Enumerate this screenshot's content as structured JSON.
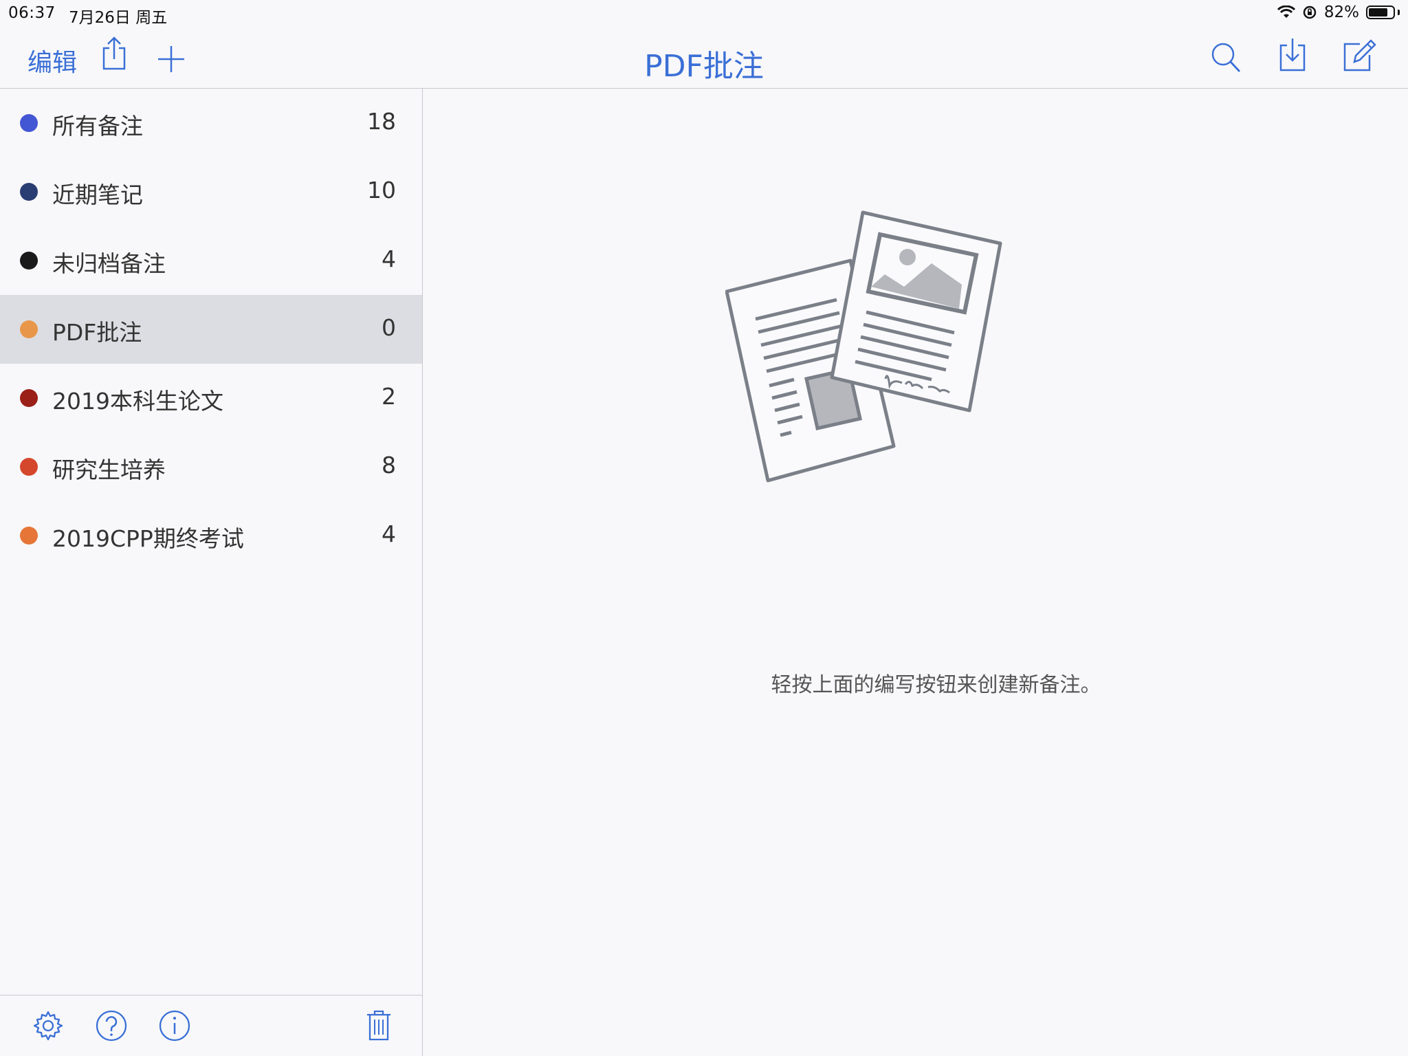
{
  "status": {
    "time": "06:37",
    "date": "7月26日 周五",
    "battery": "82%",
    "battery_level": 0.82
  },
  "nav": {
    "edit_label": "编辑",
    "title": "PDF批注"
  },
  "sidebar": {
    "items": [
      {
        "label": "所有备注",
        "count": "18",
        "color": "#4356d4"
      },
      {
        "label": "近期笔记",
        "count": "10",
        "color": "#2a3d73"
      },
      {
        "label": "未归档备注",
        "count": "4",
        "color": "#1a1a1a"
      },
      {
        "label": "PDF批注",
        "count": "0",
        "color": "#e8974a",
        "selected": true
      },
      {
        "label": "2019本科生论文",
        "count": "2",
        "color": "#9b2018"
      },
      {
        "label": "研究生培养",
        "count": "8",
        "color": "#d5472c"
      },
      {
        "label": "2019CPP期终考试",
        "count": "4",
        "color": "#e67638"
      }
    ]
  },
  "content": {
    "hint": "轻按上面的编写按钮来创建新备注。"
  },
  "colors": {
    "accent": "#3a6fd6",
    "selected_bg": "#dcdde2",
    "illustration": "#7a7f88"
  }
}
